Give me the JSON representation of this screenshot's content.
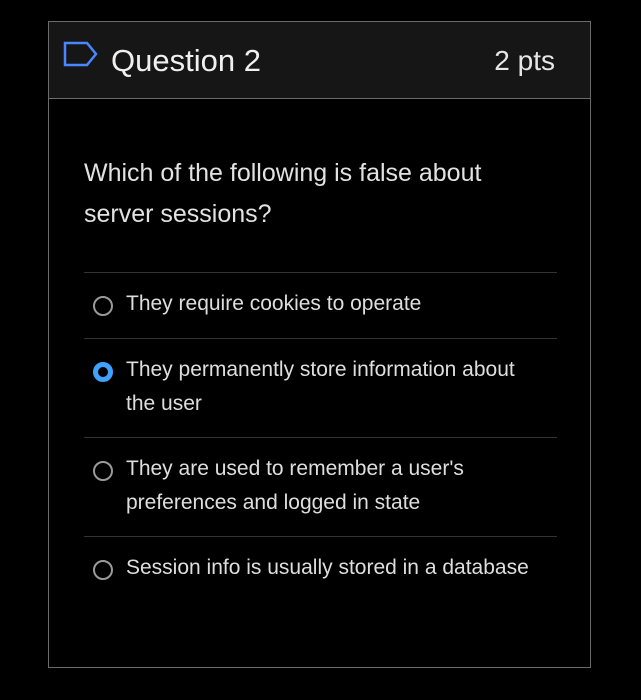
{
  "header": {
    "title": "Question 2",
    "points": "2 pts",
    "icon": "flag-icon"
  },
  "question": {
    "text": "Which of the following is false about server sessions?"
  },
  "answers": [
    {
      "label": "They require cookies to operate",
      "selected": false
    },
    {
      "label": "They permanently store information about the user",
      "selected": true
    },
    {
      "label": "They are used to remember a user's preferences and logged in state",
      "selected": false
    },
    {
      "label": "Session info is usually stored in a database",
      "selected": false
    }
  ],
  "colors": {
    "background": "#000000",
    "header_bg": "#161616",
    "border": "#6b6b6b",
    "accent_radio": "#3fa2ff",
    "text": "#e2e2e2"
  }
}
